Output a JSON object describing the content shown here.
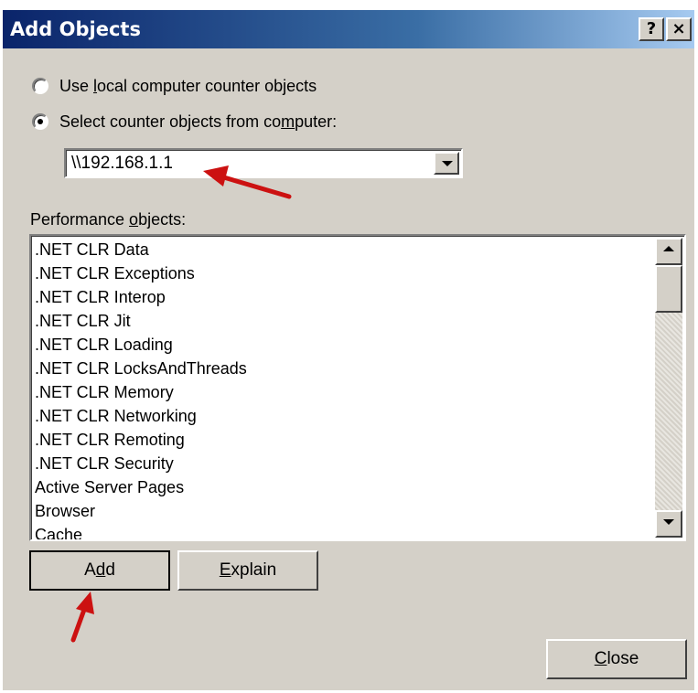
{
  "window": {
    "title": "Add Objects",
    "help_button": "?",
    "close_button": "×"
  },
  "radio": {
    "local": {
      "label_pre": "Use ",
      "label_ul": "l",
      "label_post": "ocal computer counter objects",
      "checked": false
    },
    "remote": {
      "label_pre": "Select counter objects from co",
      "label_ul": "m",
      "label_post": "puter:",
      "checked": true
    }
  },
  "computer_combo": {
    "value": "\\\\192.168.1.1"
  },
  "performance_objects": {
    "label_pre": "Performance ",
    "label_ul": "o",
    "label_post": "bjects:",
    "items": [
      ".NET CLR Data",
      ".NET CLR Exceptions",
      ".NET CLR Interop",
      ".NET CLR Jit",
      ".NET CLR Loading",
      ".NET CLR LocksAndThreads",
      ".NET CLR Memory",
      ".NET CLR Networking",
      ".NET CLR Remoting",
      ".NET CLR Security",
      "Active Server Pages",
      "Browser",
      "Cache"
    ]
  },
  "buttons": {
    "add": {
      "pre": "A",
      "ul": "d",
      "post": "d"
    },
    "explain": {
      "pre": "",
      "ul": "E",
      "post": "xplain"
    },
    "close": {
      "pre": "",
      "ul": "C",
      "post": "lose"
    }
  },
  "colors": {
    "dialog_face": "#d4d0c8",
    "title_start": "#0a246a",
    "title_end": "#a6caf0",
    "annotation_arrow": "#cc1111"
  }
}
